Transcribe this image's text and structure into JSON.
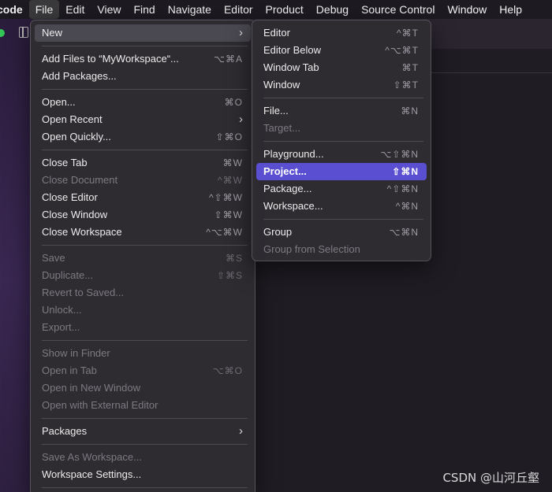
{
  "menubar": {
    "items": [
      "code",
      "File",
      "Edit",
      "View",
      "Find",
      "Navigate",
      "Editor",
      "Product",
      "Debug",
      "Source Control",
      "Window",
      "Help"
    ]
  },
  "file_menu": {
    "new": {
      "label": "New"
    },
    "add_files": {
      "label": "Add Files to “MyWorkspace“...",
      "shortcut": "⌥⌘A"
    },
    "add_packages": {
      "label": "Add Packages..."
    },
    "open": {
      "label": "Open...",
      "shortcut": "⌘O"
    },
    "open_recent": {
      "label": "Open Recent"
    },
    "open_quickly": {
      "label": "Open Quickly...",
      "shortcut": "⇧⌘O"
    },
    "close_tab": {
      "label": "Close Tab",
      "shortcut": "⌘W"
    },
    "close_document": {
      "label": "Close Document",
      "shortcut": "^⌘W"
    },
    "close_editor": {
      "label": "Close Editor",
      "shortcut": "^⇧⌘W"
    },
    "close_window": {
      "label": "Close Window",
      "shortcut": "⇧⌘W"
    },
    "close_workspace": {
      "label": "Close Workspace",
      "shortcut": "^⌥⌘W"
    },
    "save": {
      "label": "Save",
      "shortcut": "⌘S"
    },
    "duplicate": {
      "label": "Duplicate...",
      "shortcut": "⇧⌘S"
    },
    "revert": {
      "label": "Revert to Saved..."
    },
    "unlock": {
      "label": "Unlock..."
    },
    "export": {
      "label": "Export..."
    },
    "show_in_finder": {
      "label": "Show in Finder"
    },
    "open_in_tab": {
      "label": "Open in Tab",
      "shortcut": "⌥⌘O"
    },
    "open_new_window": {
      "label": "Open in New Window"
    },
    "open_external": {
      "label": "Open with External Editor"
    },
    "packages": {
      "label": "Packages"
    },
    "save_as_workspace": {
      "label": "Save As Workspace..."
    },
    "workspace_settings": {
      "label": "Workspace Settings..."
    }
  },
  "new_submenu": {
    "editor": {
      "label": "Editor",
      "shortcut": "^⌘T"
    },
    "editor_below": {
      "label": "Editor Below",
      "shortcut": "^⌥⌘T"
    },
    "window_tab": {
      "label": "Window Tab",
      "shortcut": "⌘T"
    },
    "window": {
      "label": "Window",
      "shortcut": "⇧⌘T"
    },
    "file": {
      "label": "File...",
      "shortcut": "⌘N"
    },
    "target": {
      "label": "Target..."
    },
    "playground": {
      "label": "Playground...",
      "shortcut": "⌥⇧⌘N"
    },
    "project": {
      "label": "Project...",
      "shortcut": "⇧⌘N"
    },
    "package": {
      "label": "Package...",
      "shortcut": "^⇧⌘N"
    },
    "workspace": {
      "label": "Workspace...",
      "shortcut": "^⌘N"
    },
    "group": {
      "label": "Group",
      "shortcut": "⌥⌘N"
    },
    "group_from_selection": {
      "label": "Group from Selection"
    }
  },
  "watermark": "CSDN @山河丘壑",
  "colors": {
    "highlight": "#5a4fd0",
    "menu_bg": "#2e2c32",
    "sidebar_accent": "#3a2752"
  }
}
